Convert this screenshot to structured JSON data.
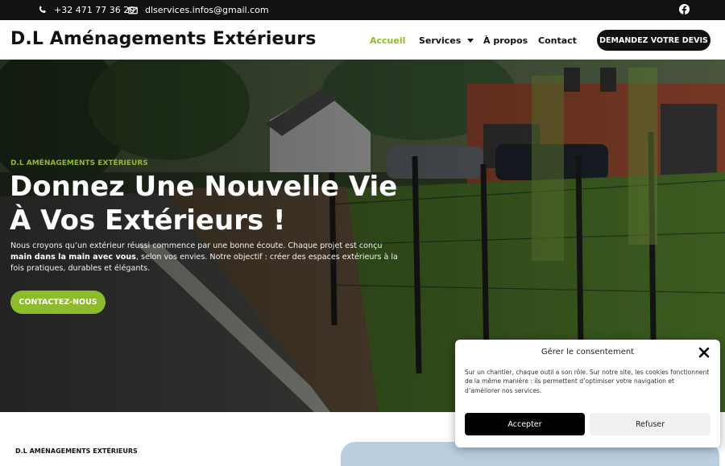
{
  "topbar": {
    "phone": "+32 471 77 36 20",
    "email": "dlservices.infos@gmail.com"
  },
  "header": {
    "logo": "D.L Aménagements Extérieurs",
    "nav": {
      "home": "Accueil",
      "services": "Services",
      "about": "À propos",
      "contact": "Contact"
    },
    "cta": "DEMANDEZ VOTRE DEVIS"
  },
  "hero": {
    "eyebrow": "D.L AMÉNAGEMENTS EXTÉRIEURS",
    "title_line1": "Donnez Une Nouvelle Vie",
    "title_line2": "À Vos Extérieurs !",
    "lead": {
      "part1": "Nous croyons qu’un extérieur réussi commence par une bonne écoute. Chaque projet est conçu ",
      "bold": "main dans la main avec vous",
      "part2": ", selon vos envies. Notre objectif : créer des espaces extérieurs à la fois pratiques, durables et élégants."
    },
    "cta": "CONTACTEZ-NOUS"
  },
  "section": {
    "title": "D.L AMÉNAGEMENTS EXTÉRIEURS"
  },
  "consent": {
    "title": "Gérer le consentement",
    "text": "Sur un chantier, chaque outil a son rôle. Sur notre site, les cookies fonctionnent de la même manière : ils permettent d’optimiser votre navigation et d’améliorer nos services.",
    "accept": "Accepter",
    "refuse": "Refuser"
  },
  "colors": {
    "accent": "#8dbb2a",
    "dark": "#111111"
  },
  "icons": [
    "phone-icon",
    "envelope-icon",
    "facebook-icon",
    "chevron-down-icon",
    "close-icon"
  ]
}
